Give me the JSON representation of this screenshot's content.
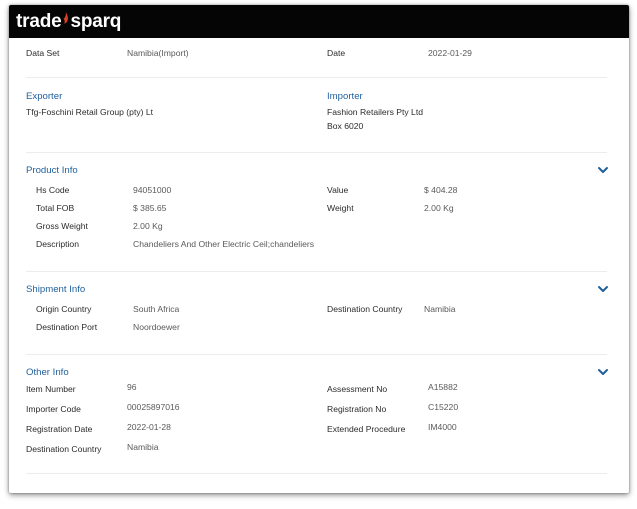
{
  "brand": {
    "name_part1": "trade",
    "name_part2": "sparq",
    "flame_color": "#d9412b"
  },
  "accent_color": "#1f5f9c",
  "summary": {
    "dataset_label": "Data Set",
    "dataset_value": "Namibia(Import)",
    "date_label": "Date",
    "date_value": "2022-01-29"
  },
  "parties": {
    "exporter_title": "Exporter",
    "exporter_name": "Tfg-Foschini Retail Group (pty) Lt",
    "importer_title": "Importer",
    "importer_name": "Fashion Retailers Pty Ltd",
    "importer_address": "Box 6020"
  },
  "product": {
    "title": "Product Info",
    "hs_code_label": "Hs Code",
    "hs_code_value": "94051000",
    "value_label": "Value",
    "value_value": "$ 404.28",
    "total_fob_label": "Total FOB",
    "total_fob_value": "$ 385.65",
    "weight_label": "Weight",
    "weight_value": "2.00 Kg",
    "gross_weight_label": "Gross Weight",
    "gross_weight_value": "2.00 Kg",
    "description_label": "Description",
    "description_value": "Chandeliers And Other Electric Ceil;chandeliers"
  },
  "shipment": {
    "title": "Shipment Info",
    "origin_country_label": "Origin Country",
    "origin_country_value": "South Africa",
    "destination_country_label": "Destination Country",
    "destination_country_value": "Namibia",
    "destination_port_label": "Destination Port",
    "destination_port_value": "Noordoewer"
  },
  "other": {
    "title": "Other Info",
    "item_number_label": "Item Number",
    "item_number_value": "96",
    "assessment_no_label": "Assessment No",
    "assessment_no_value": "A15882",
    "importer_code_label": "Importer Code",
    "importer_code_value": "00025897016",
    "registration_no_label": "Registration No",
    "registration_no_value": "C15220",
    "registration_date_label": "Registration Date",
    "registration_date_value": "2022-01-28",
    "extended_procedure_label": "Extended Procedure",
    "extended_procedure_value": "IM4000",
    "destination_country_label": "Destination Country",
    "destination_country_value": "Namibia"
  },
  "icons": {
    "section_toggle": "chevron-down-icon",
    "logo_flame": "flame-icon"
  }
}
